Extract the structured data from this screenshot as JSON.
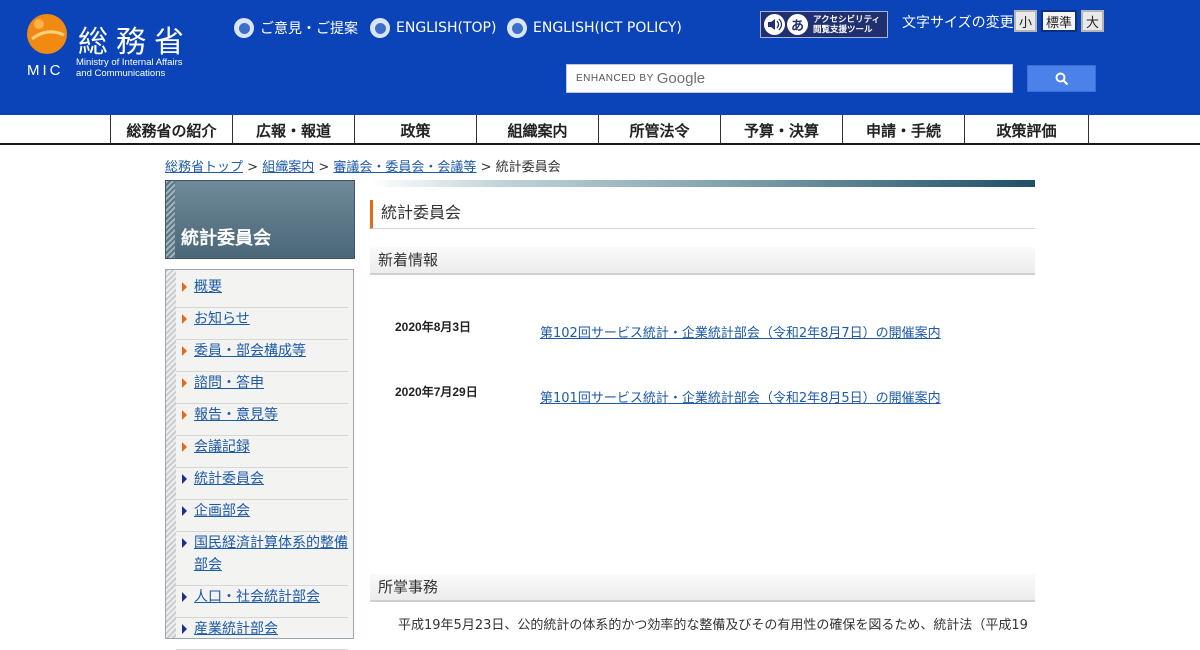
{
  "header": {
    "logo": {
      "jp": "総務省",
      "mic": "MIC",
      "en_line1": "Ministry of Internal Affairs",
      "en_line2": "and Communications"
    },
    "top_links": [
      "ご意見・ご提案",
      "ENGLISH(TOP)",
      "ENGLISH(ICT POLICY)"
    ],
    "accessibility": {
      "icon1": "speaker-icon",
      "icon2_glyph": "あ",
      "line1": "アクセシビリティ",
      "line2": "閲覧支援ツール"
    },
    "font_size": {
      "label": "文字サイズの変更",
      "small": "小",
      "normal": "標準",
      "large": "大"
    },
    "search": {
      "enhanced": "ENHANCED BY",
      "google": "Google",
      "button_icon": "search-icon"
    }
  },
  "gnav": [
    "総務省の紹介",
    "広報・報道",
    "政策",
    "組織案内",
    "所管法令",
    "予算・決算",
    "申請・手続",
    "政策評価"
  ],
  "breadcrumb": {
    "links": [
      "総務省トップ",
      "組織案内",
      "審議会・委員会・会議等"
    ],
    "separator": ">",
    "current": "統計委員会"
  },
  "sidebar": {
    "title": "統計委員会",
    "items": [
      {
        "label": "概要",
        "arrow": "orange"
      },
      {
        "label": "お知らせ",
        "arrow": "orange"
      },
      {
        "label": "委員・部会構成等",
        "arrow": "orange"
      },
      {
        "label": "諮問・答申",
        "arrow": "orange"
      },
      {
        "label": "報告・意見等",
        "arrow": "orange"
      },
      {
        "label": "会議記録",
        "arrow": "orange"
      },
      {
        "label": "統計委員会",
        "arrow": "blue"
      },
      {
        "label": "企画部会",
        "arrow": "blue"
      },
      {
        "label": "国民経済計算体系的整備部会",
        "arrow": "blue"
      },
      {
        "label": "人口・社会統計部会",
        "arrow": "blue"
      },
      {
        "label": "産業統計部会",
        "arrow": "blue"
      }
    ]
  },
  "main": {
    "title": "統計委員会",
    "news": {
      "heading": "新着情報",
      "items": [
        {
          "date": "2020年8月3日",
          "text": "第102回サービス統計・企業統計部会（令和2年8月7日）の開催案内"
        },
        {
          "date": "2020年7月29日",
          "text": "第101回サービス統計・企業統計部会（令和2年8月5日）の開催案内"
        }
      ]
    },
    "duties": {
      "heading": "所掌事務",
      "text": "平成19年5月23日、公的統計の体系的かつ効率的な整備及びその有用性の確保を図るため、統計法（平成19"
    }
  },
  "colors": {
    "header_bg": "#0b44b8",
    "accent": "#e36a18",
    "link": "#1d5aa8"
  }
}
